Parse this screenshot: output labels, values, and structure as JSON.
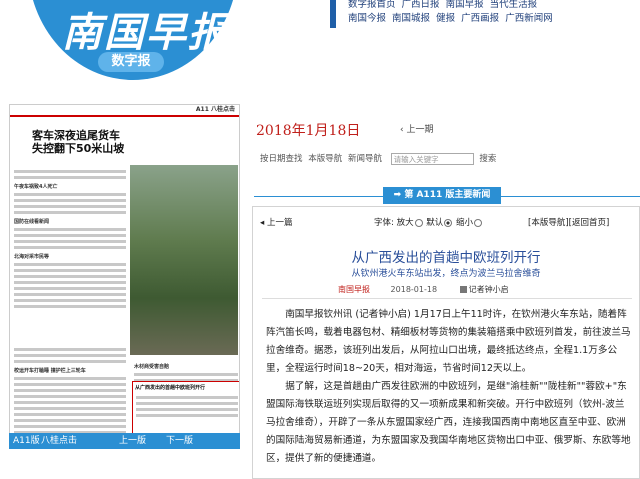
{
  "header": {
    "logo_text": "南国早报",
    "logo_badge": "数字报",
    "links_row1": [
      "数字报首页",
      "广西日报",
      "南国早报",
      "当代生活报"
    ],
    "links_row2": [
      "南国今报",
      "南国城报",
      "健报",
      "广西画报",
      "广西新闻网"
    ]
  },
  "thumbnail": {
    "top_text": "A11 八桂点击",
    "headline_line1": "客车深夜追尾货车",
    "headline_line2": "失控翻下50米山坡",
    "sub_headlines": [
      "午夜车祸致4人死亡",
      "国防在线看新闻",
      "北海对采市民等",
      "校运开车打瞌睡 撞护栏上三轮车",
      "木材商受害自赔"
    ],
    "highlight_title": "从广西发出的首趟中欧班列开行",
    "nav": {
      "page_label": "A11版",
      "section_label": "八桂点击",
      "prev_label": "上一版",
      "next_label": "下一版"
    }
  },
  "date": "2018年1月18日",
  "prev_edition": "上一期",
  "toolbar": {
    "items": [
      "按日期查找",
      "本版导航",
      "新闻导航"
    ],
    "search_placeholder": "请输入关键字",
    "search_button": "搜索"
  },
  "edition_tab": "第 A111 版主要新闻",
  "article_nav": {
    "prev": "上一篇",
    "font_label": "字体:",
    "font_large": "放大",
    "font_default": "默认",
    "font_small": "缩小",
    "page_nav": "[本版导航]",
    "back_home": "[返回首页]"
  },
  "article": {
    "title": "从广西发出的首趟中欧班列开行",
    "subtitle": "从钦州港火车东站出发，终点为波兰马拉舍维奇",
    "source": "南国早报",
    "date": "2018-01-18",
    "reporter": "记者钟小启",
    "paragraphs": [
      "南国早报钦州讯 (记者钟小启) 1月17日上午11时许，在钦州港火车东站，随着阵阵汽笛长鸣，载着电器包材、精细板材等货物的集装箱搭乘中欧班列首发，前往波兰马拉舍维奇。据悉，该班列出发后，从阿拉山口出境，最终抵达终点，全程1.1万多公里，全程运行时间18~20天，相对海运，节省时间12天以上。",
      "据了解，这是首趟由广西发往欧洲的中欧班列，是继\"渝桂新\"\"陇桂新\"\"蓉欧+\"东盟国际海铁联运班列实现后取得的又一项新成果和新突破。开行中欧班列（钦州-波兰马拉舍维奇），开辟了一条从东盟国家经广西，连接我国西南中南地区直至中亚、欧洲的国际陆海贸易新通道，为东盟国家及我国华南地区货物出口中亚、俄罗斯、东欧等地区，提供了新的便捷通道。"
    ]
  },
  "colors": {
    "brand_blue": "#2b8fd3",
    "title_blue": "#2a4f9a",
    "date_red": "#c0201b"
  }
}
